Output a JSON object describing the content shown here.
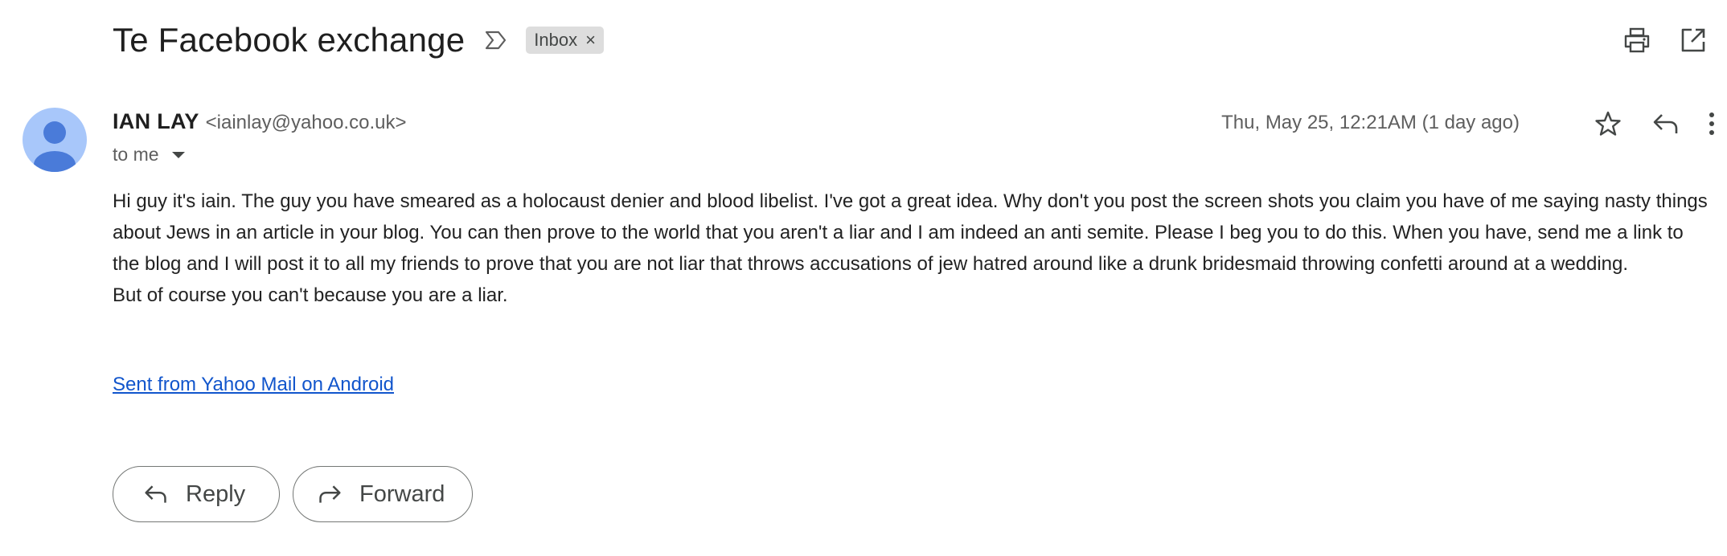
{
  "message": {
    "subject": "Te Facebook exchange",
    "label_chip": "Inbox",
    "label_remove": "×",
    "sender_name": "IAN LAY",
    "sender_email": "<iainlay@yahoo.co.uk>",
    "recipient": "to me",
    "date": "Thu, May 25, 12:21AM (1 day ago)",
    "body_lines": [
      "Hi guy it's iain. The guy you have smeared as a holocaust denier and blood libelist. I've got a great idea. Why don't you post the screen shots you claim you have of me saying nasty things about Jews in an article in your blog. You can then prove to the world that you aren't a liar and I am indeed an anti semite. Please I beg you to do this. When you have, send me a link to the blog and I will post it to all my friends to prove that you are not liar that throws accusations of jew hatred around like a drunk bridesmaid throwing confetti around at a wedding.",
      "But of course you can't because you are a liar."
    ],
    "signature_link": "Sent from Yahoo Mail on Android"
  },
  "actions": {
    "reply_label": "Reply",
    "forward_label": "Forward"
  },
  "icons": {
    "importance": "label-importance-icon",
    "print": "print-icon",
    "open_new_window": "open-in-new-icon",
    "star": "star-icon",
    "reply": "reply-icon",
    "more": "more-vert-icon",
    "forward": "forward-icon"
  },
  "colors": {
    "avatar_bg": "#a8c7fa",
    "avatar_fg": "#4a7bd9",
    "link": "#1155cc",
    "chip_bg": "#dddddd",
    "button_border": "#747775"
  }
}
